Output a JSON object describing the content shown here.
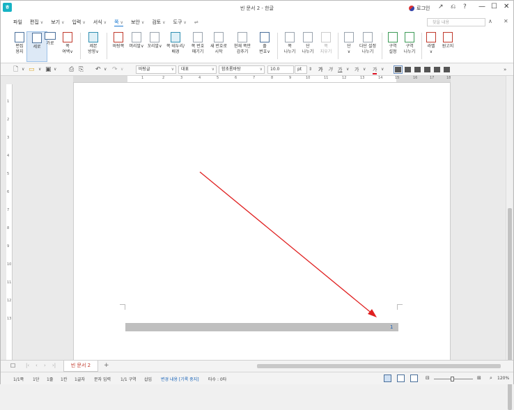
{
  "window": {
    "title": "빈 문서 2 - 한글",
    "app_icon": "ㅎ",
    "login_label": "로그인",
    "controls": [
      "↗",
      "⎌",
      "?",
      "—",
      "☐",
      "✕"
    ]
  },
  "menubar": {
    "file": "파일",
    "items": [
      {
        "label": "편집",
        "icon": "chevron-down-icon"
      },
      {
        "label": "보기",
        "icon": "chevron-down-icon"
      },
      {
        "label": "입력",
        "icon": "chevron-down-icon"
      },
      {
        "label": "서식",
        "icon": "chevron-down-icon"
      },
      {
        "label": "쪽",
        "icon": "chevron-down-icon",
        "active": true
      },
      {
        "label": "보안",
        "icon": "chevron-down-icon"
      },
      {
        "label": "검토",
        "icon": "chevron-down-icon"
      },
      {
        "label": "도구",
        "icon": "chevron-down-icon"
      }
    ],
    "search_placeholder": "찾을 내용",
    "accent_color": "#1677d2"
  },
  "ribbon": {
    "buttons": [
      {
        "label": "편집\n용지",
        "icon": "page-setup-icon"
      },
      {
        "label": "세로",
        "icon": "portrait-icon",
        "selected": true
      },
      {
        "label": "가로",
        "icon": "landscape-icon"
      },
      {
        "label": "쪽\n여백∨",
        "icon": "margin-icon"
      },
      {
        "label": "제본\n방향∨",
        "icon": "binding-icon"
      },
      {
        "label": "바탕쪽",
        "icon": "master-page-icon"
      },
      {
        "label": "머리말∨",
        "icon": "header-icon"
      },
      {
        "label": "꼬리말∨",
        "icon": "footer-icon"
      },
      {
        "label": "쪽 테두리/\n배경",
        "icon": "page-border-icon"
      },
      {
        "label": "쪽 번호\n매기기",
        "icon": "page-number-icon"
      },
      {
        "label": "새 번호로\n시작",
        "icon": "new-number-icon"
      },
      {
        "label": "현재 쪽만\n감추기",
        "icon": "hide-page-icon"
      },
      {
        "label": "줄\n번호∨",
        "icon": "line-number-icon"
      },
      {
        "label": "쪽\n나누기",
        "icon": "page-break-icon"
      },
      {
        "label": "단\n나누기",
        "icon": "column-break-icon"
      },
      {
        "label": "쪽\n지우기",
        "icon": "delete-page-icon"
      },
      {
        "label": "단\n∨",
        "icon": "columns-icon"
      },
      {
        "label": "다단 설정\n나누기",
        "icon": "multi-column-icon"
      },
      {
        "label": "구역\n설정",
        "icon": "section-icon"
      },
      {
        "label": "구역\n나누기",
        "icon": "section-break-icon"
      },
      {
        "label": "라벨\n∨",
        "icon": "label-icon"
      },
      {
        "label": "원고지",
        "icon": "manuscript-icon"
      }
    ]
  },
  "toolbar": {
    "style": "바탕글",
    "font_lang": "대표",
    "font": "함초롬바탕",
    "font_size": "10.0",
    "unit": "pt",
    "bold": "가",
    "italic": "가",
    "underline": "가",
    "strike": "가",
    "color_glyph": "가"
  },
  "ruler": {
    "h_ticks": [
      "1",
      "2",
      "3",
      "4",
      "5",
      "6",
      "7",
      "8",
      "9",
      "10",
      "11",
      "12",
      "13",
      "14",
      "15",
      "16",
      "17",
      "18"
    ],
    "v_ticks": [
      "1",
      "2",
      "3",
      "4",
      "5",
      "6",
      "7",
      "8",
      "9",
      "10",
      "11",
      "12",
      "13"
    ]
  },
  "document": {
    "page_number": "1",
    "arrow_color": "#e02020",
    "footer_color": "#bfbfbf"
  },
  "tabs": {
    "doc_tab": "빈 문서 2",
    "add": "+"
  },
  "statusbar": {
    "page": "1/1쪽",
    "column": "1단",
    "line": "1줄",
    "char": "1칸",
    "count": "1글자",
    "mode": "문자 입력",
    "section": "1/1 구역",
    "insert": "삽입",
    "track": "변경 내용 [기록 중지]",
    "char_count": "타수 : 0타",
    "zoom": "120%"
  }
}
